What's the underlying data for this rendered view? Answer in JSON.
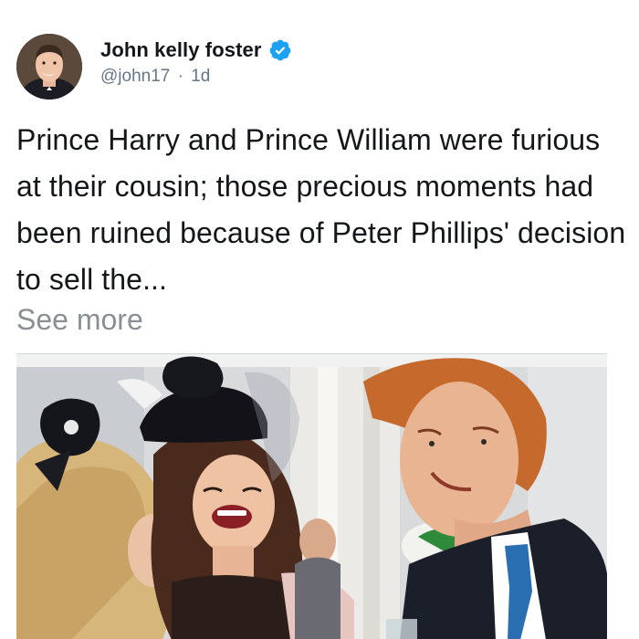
{
  "author": {
    "display_name": "John kelly foster",
    "handle": "@john17",
    "separator": "·",
    "time_ago": "1d",
    "verified": true,
    "avatar_icon": "profile-photo"
  },
  "post": {
    "text": "Prince Harry and Prince William were furious at their cousin; those precious moments had been ruined because of Peter Phillips' decision to sell the...",
    "see_more_label": "See more",
    "media_type": "photo"
  },
  "colors": {
    "text": "#14171a",
    "secondary_text": "#657786",
    "see_more": "#8a8f94",
    "verified_badge": "#1da1f2"
  }
}
